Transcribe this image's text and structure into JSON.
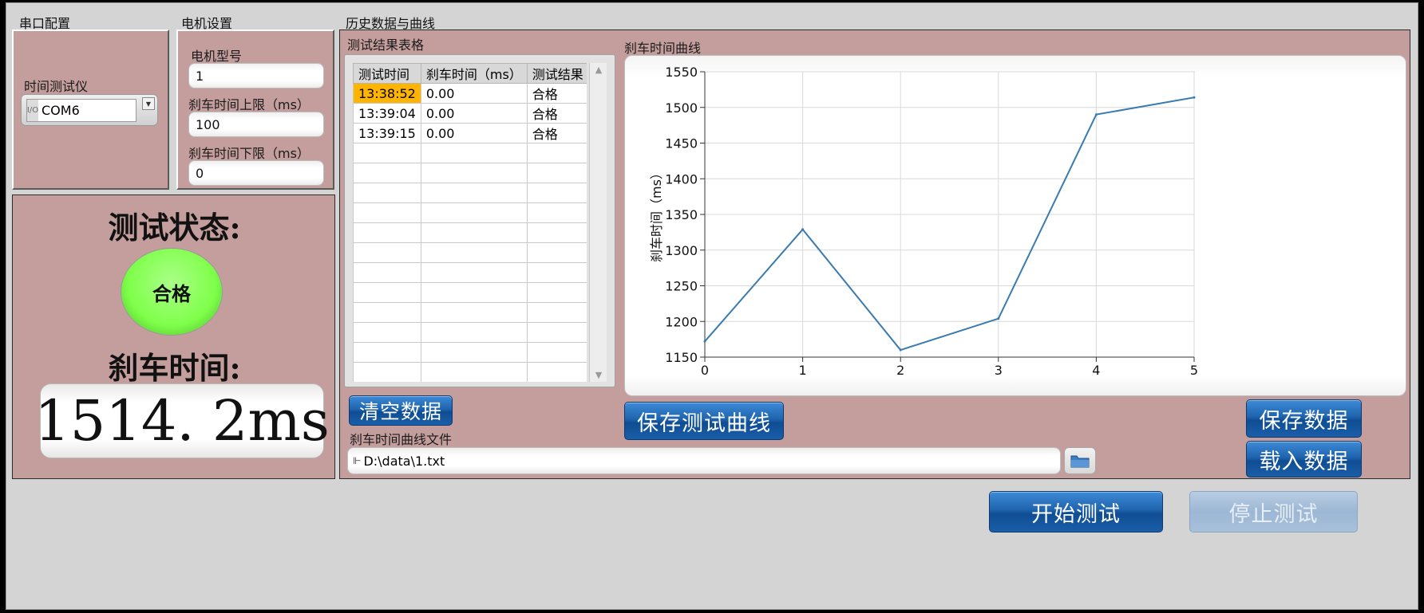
{
  "serial": {
    "section_title": "串口配置",
    "device_label": "时间测试仪",
    "port_prefix": "I/O",
    "port_value": "COM6"
  },
  "motor": {
    "section_title": "电机设置",
    "model_label": "电机型号",
    "model_value": "1",
    "upper_label": "刹车时间上限（ms）",
    "upper_value": "100",
    "lower_label": "刹车时间下限（ms）",
    "lower_value": "0"
  },
  "status": {
    "title": "测试状态:",
    "indicator_text": "合格",
    "indicator_color": "#7fff4a",
    "brake_label": "刹车时间:",
    "brake_value": "1514. 2ms"
  },
  "history": {
    "section_title": "历史数据与曲线",
    "table_title": "测试结果表格",
    "chart_title": "刹车时间曲线",
    "columns": [
      "测试时间",
      "刹车时间（ms）",
      "测试结果"
    ],
    "rows": [
      [
        "13:38:52",
        "0.00",
        "合格"
      ],
      [
        "13:39:04",
        "0.00",
        "合格"
      ],
      [
        "13:39:15",
        "0.00",
        "合格"
      ]
    ],
    "empty_rows": 12,
    "highlight_color": "#ffb400"
  },
  "chart_data": {
    "type": "line",
    "title": "刹车时间曲线",
    "xlabel": "",
    "ylabel": "刹车时间（ms）",
    "x": [
      0,
      1,
      2,
      3,
      4,
      5
    ],
    "series": [
      {
        "values": [
          1172,
          1329,
          1160,
          1204,
          1490,
          1514
        ],
        "color": "#3a7bb0"
      }
    ],
    "xlim": [
      0,
      5
    ],
    "ylim": [
      1150,
      1550
    ],
    "xticks": [
      0,
      1,
      2,
      3,
      4,
      5
    ],
    "yticks": [
      1150,
      1200,
      1250,
      1300,
      1350,
      1400,
      1450,
      1500,
      1550
    ],
    "grid": true
  },
  "file": {
    "label": "刹车时间曲线文件",
    "path": "D:\\data\\1.txt"
  },
  "buttons": {
    "clear": "清空数据",
    "save_curve": "保存测试曲线",
    "save_data": "保存数据",
    "load_data": "载入数据",
    "start": "开始测试",
    "stop": "停止测试"
  }
}
